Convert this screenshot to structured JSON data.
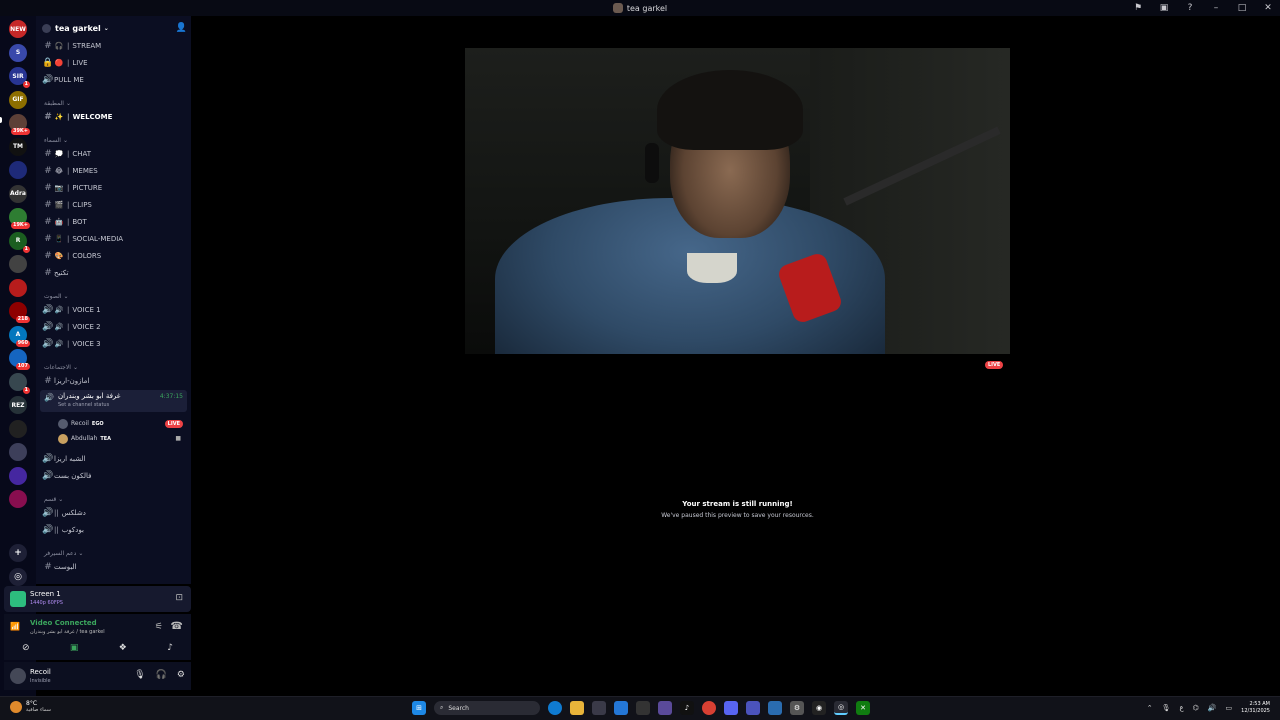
{
  "window": {
    "title": "tea garkel",
    "controls": [
      "flag",
      "inbox",
      "help",
      "minimize",
      "maximize",
      "close"
    ]
  },
  "servers": [
    {
      "label": "NEW",
      "color": "#c62828",
      "badge": ""
    },
    {
      "label": "S",
      "color": "#3949ab",
      "badge": ""
    },
    {
      "label": "SIR",
      "color": "#283593",
      "badge": "1"
    },
    {
      "label": "GIF",
      "color": "#8d6e00",
      "badge": ""
    },
    {
      "label": "",
      "color": "#5d4037",
      "badge": "39K+"
    },
    {
      "label": "TM",
      "color": "#111111",
      "badge": ""
    },
    {
      "label": "",
      "color": "#1e2a78",
      "badge": ""
    },
    {
      "label": "Adra",
      "color": "#333333",
      "badge": ""
    },
    {
      "label": "",
      "color": "#2e7d32",
      "badge": "19K+"
    },
    {
      "label": "R",
      "color": "#1b5e20",
      "badge": "1"
    },
    {
      "label": "",
      "color": "#424242",
      "badge": ""
    },
    {
      "label": "",
      "color": "#b71c1c",
      "badge": ""
    },
    {
      "label": "",
      "color": "#8e0000",
      "badge": "218"
    },
    {
      "label": "A",
      "color": "#0277bd",
      "badge": "960"
    },
    {
      "label": "",
      "color": "#1565c0",
      "badge": "107"
    },
    {
      "label": "",
      "color": "#37474f",
      "badge": "1"
    },
    {
      "label": "REZ",
      "color": "#263238",
      "badge": ""
    },
    {
      "label": "",
      "color": "#212121",
      "badge": ""
    },
    {
      "label": "",
      "color": "#3d3f5a",
      "badge": ""
    },
    {
      "label": "",
      "color": "#4527a0",
      "badge": ""
    },
    {
      "label": "",
      "color": "#880e4f",
      "badge": ""
    }
  ],
  "server": {
    "name": "tea garkel"
  },
  "channels": {
    "top": [
      {
        "icon": "🎧",
        "name": "STREAM"
      },
      {
        "icon": "🔴",
        "name": "LIVE"
      },
      {
        "icon": "",
        "name": "PULL ME"
      }
    ],
    "cat1": "المطبقة",
    "welcome": {
      "icon": "✨",
      "name": "WELCOME"
    },
    "cat2": "السماء",
    "text": [
      {
        "icon": "💭",
        "name": "CHAT"
      },
      {
        "icon": "😂",
        "name": "MEMES"
      },
      {
        "icon": "📷",
        "name": "PICTURE"
      },
      {
        "icon": "🎬",
        "name": "CLIPS"
      },
      {
        "icon": "🤖",
        "name": "BOT"
      },
      {
        "icon": "📱",
        "name": "SOCIAL-MEDIA"
      },
      {
        "icon": "🎨",
        "name": "COLORS"
      }
    ],
    "arabic1": "تكتيح",
    "cat3": "الصوت",
    "voice": [
      {
        "name": "VOICE 1"
      },
      {
        "name": "VOICE 2"
      },
      {
        "name": "VOICE 3"
      }
    ],
    "cat4": "الاجتماعات",
    "voice_arabic": "امازون-اريزا",
    "active_vc": {
      "name": "غرفة ابو بشر وبندران",
      "status": "Set a channel status",
      "time": "4:37:15"
    },
    "vc_users": [
      {
        "name": "Recoil",
        "tag": "EGO",
        "live": "LIVE"
      },
      {
        "name": "Abdullah",
        "tag": "TEA",
        "live": ""
      }
    ],
    "after_vc": [
      "الشبه اريزا",
      "فالكون بست"
    ],
    "cat5": "قسم",
    "cat5_items": [
      "دشلكس",
      "بودكوب"
    ],
    "cat6": "دعم السيرفر",
    "cat6_item": "البوست"
  },
  "screen_share": {
    "title": "Screen 1",
    "subtitle": "1440p 60FPS"
  },
  "voice_status": {
    "title": "Video Connected",
    "subtitle": "غرفة ابو بشر وبندران / tea garkel"
  },
  "user": {
    "name": "Recoil",
    "status": "Invisible"
  },
  "stream": {
    "live_label": "LIVE",
    "paused_title": "Your stream is still running!",
    "paused_sub": "We've paused this preview to save your resources."
  },
  "taskbar": {
    "weather_temp": "8°C",
    "weather_desc": "سماء صافية",
    "search_placeholder": "Search",
    "time": "2:53 AM",
    "date": "12/31/2025",
    "lang": "ع"
  }
}
